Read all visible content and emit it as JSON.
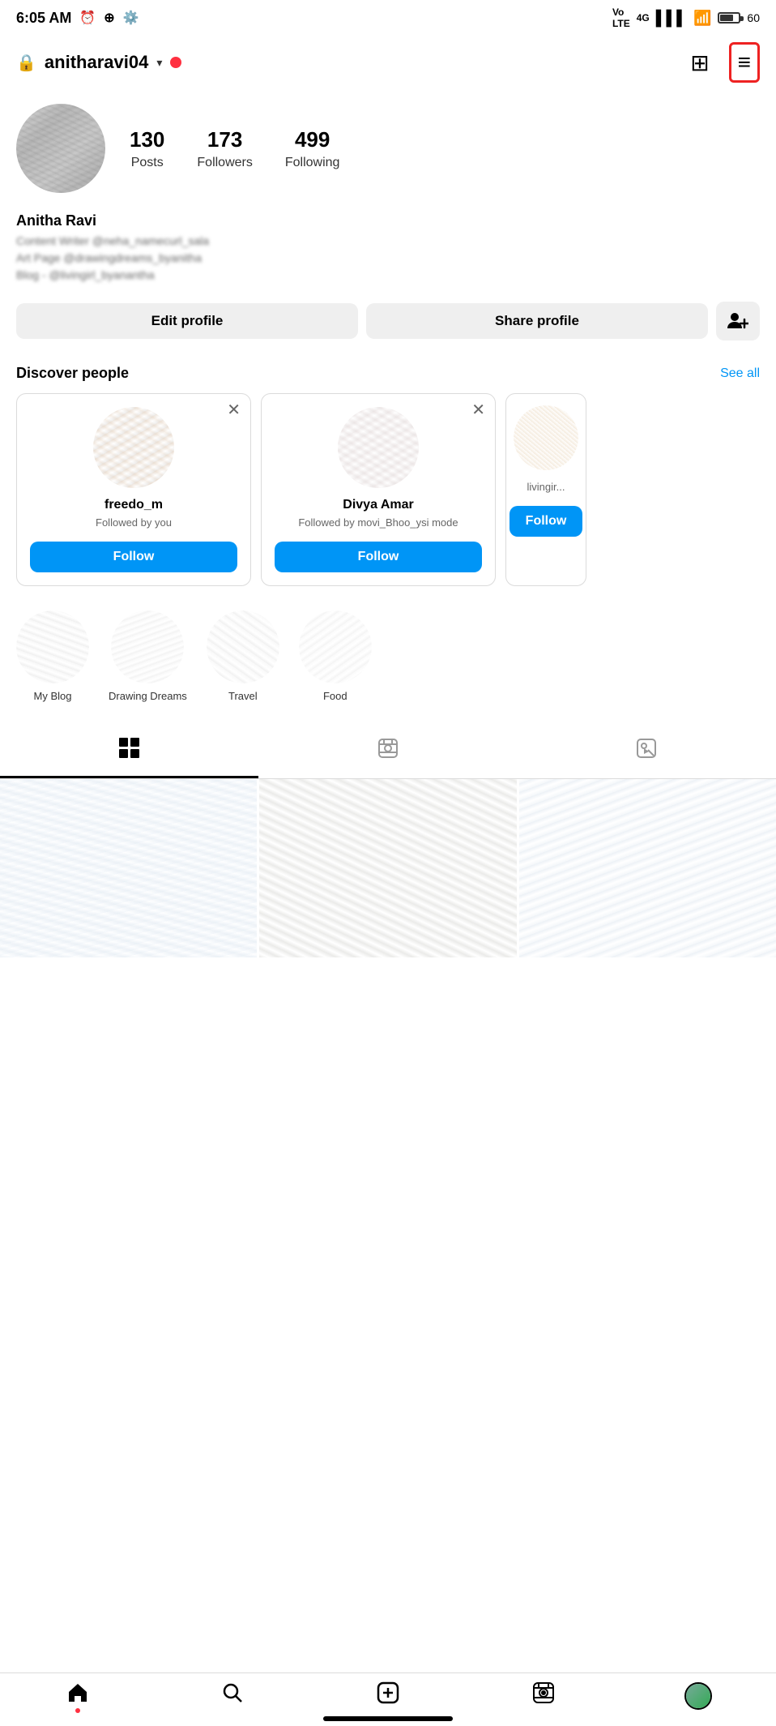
{
  "statusBar": {
    "time": "6:05 AM",
    "batteryLevel": "60"
  },
  "topNav": {
    "username": "anitharavi04",
    "addIcon": "+",
    "menuIcon": "≡"
  },
  "profile": {
    "name": "Anitha Ravi",
    "stats": {
      "posts": {
        "count": "130",
        "label": "Posts"
      },
      "followers": {
        "count": "173",
        "label": "Followers"
      },
      "following": {
        "count": "499",
        "label": "Following"
      }
    },
    "bio": [
      "Content Writer @...",
      "Art Page @drawingdreams_byanitha",
      "Blog - @livingirl_byanantha"
    ]
  },
  "buttons": {
    "editProfile": "Edit profile",
    "shareProfile": "Share profile"
  },
  "discoverPeople": {
    "title": "Discover people",
    "seeAll": "See all",
    "people": [
      {
        "name": "freedo_m",
        "desc": "Followed by you",
        "followLabel": "Follow"
      },
      {
        "name": "Divya Amar",
        "desc": "Followed by movi_Bhoo_ysi mode",
        "followLabel": "Follow"
      },
      {
        "name": "",
        "desc": "livingir...",
        "followLabel": "Follow"
      }
    ]
  },
  "highlights": [
    {
      "label": "My Blog"
    },
    {
      "label": "Drawing Dreams"
    },
    {
      "label": "Travel"
    },
    {
      "label": "Food"
    }
  ],
  "tabs": [
    {
      "icon": "grid",
      "label": "Posts",
      "active": true
    },
    {
      "icon": "reels",
      "label": "Reels",
      "active": false
    },
    {
      "icon": "tagged",
      "label": "Tagged",
      "active": false
    }
  ],
  "bottomNav": {
    "items": [
      {
        "icon": "home",
        "label": "Home",
        "hasNotification": true
      },
      {
        "icon": "search",
        "label": "Search"
      },
      {
        "icon": "add",
        "label": "Add"
      },
      {
        "icon": "reels",
        "label": "Reels"
      },
      {
        "icon": "profile",
        "label": "Profile"
      }
    ]
  }
}
